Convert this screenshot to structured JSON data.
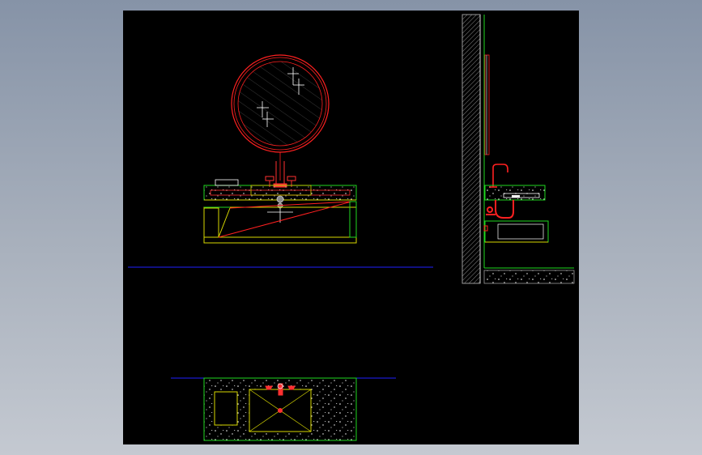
{
  "background": {
    "viewport_gradient_top": "#8693a7",
    "viewport_gradient_bottom": "#c4c9d1",
    "paper": "#000000"
  },
  "layer_colors": {
    "mirror": "#ff2020",
    "fixture": "#ff3030",
    "cabinet": "#d8d800",
    "countertop": "#20d820",
    "wall": "#9a9a9a",
    "datum_line": "#2020ff",
    "detail": "#ffffff"
  },
  "views": [
    {
      "id": "front-elevation",
      "items": [
        "round-mirror",
        "faucet",
        "stone-countertop",
        "vanity-cabinet"
      ]
    },
    {
      "id": "side-section",
      "items": [
        "wall-hatch",
        "mirror-edge",
        "faucet",
        "drain-trap",
        "drawer",
        "floor-hatch"
      ]
    },
    {
      "id": "plan-view",
      "items": [
        "stone-countertop",
        "sink-basin",
        "soap-tray",
        "faucet"
      ]
    }
  ]
}
